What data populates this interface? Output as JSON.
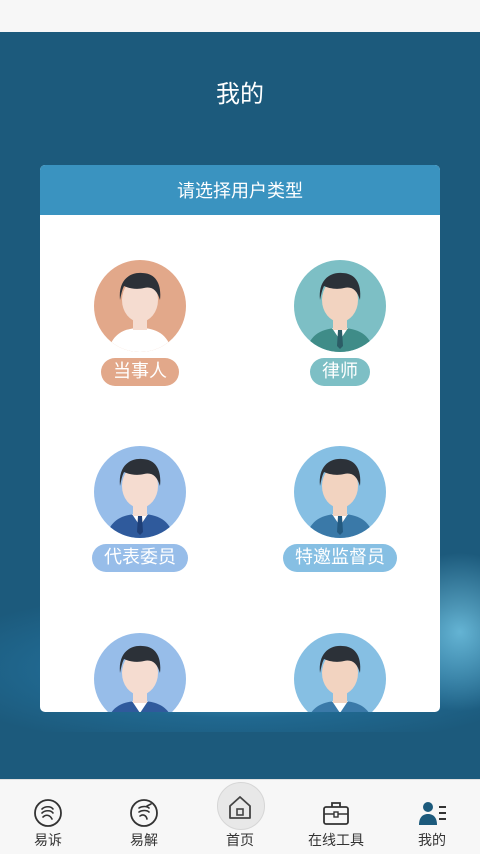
{
  "header": {
    "title": "我的"
  },
  "panel": {
    "title": "请选择用户类型",
    "user_types": [
      {
        "label": "当事人",
        "color": "#e2a88a"
      },
      {
        "label": "律师",
        "color": "#7dbfc5"
      },
      {
        "label": "代表委员",
        "color": "#97bde9"
      },
      {
        "label": "特邀监督员",
        "color": "#86bfe3"
      }
    ]
  },
  "tabbar": {
    "items": [
      {
        "label": "易诉",
        "icon": "hand-icon"
      },
      {
        "label": "易解",
        "icon": "hand-icon"
      },
      {
        "label": "首页",
        "icon": "home-icon"
      },
      {
        "label": "在线工具",
        "icon": "briefcase-icon"
      },
      {
        "label": "我的",
        "icon": "user-list-icon",
        "active": true
      }
    ]
  }
}
